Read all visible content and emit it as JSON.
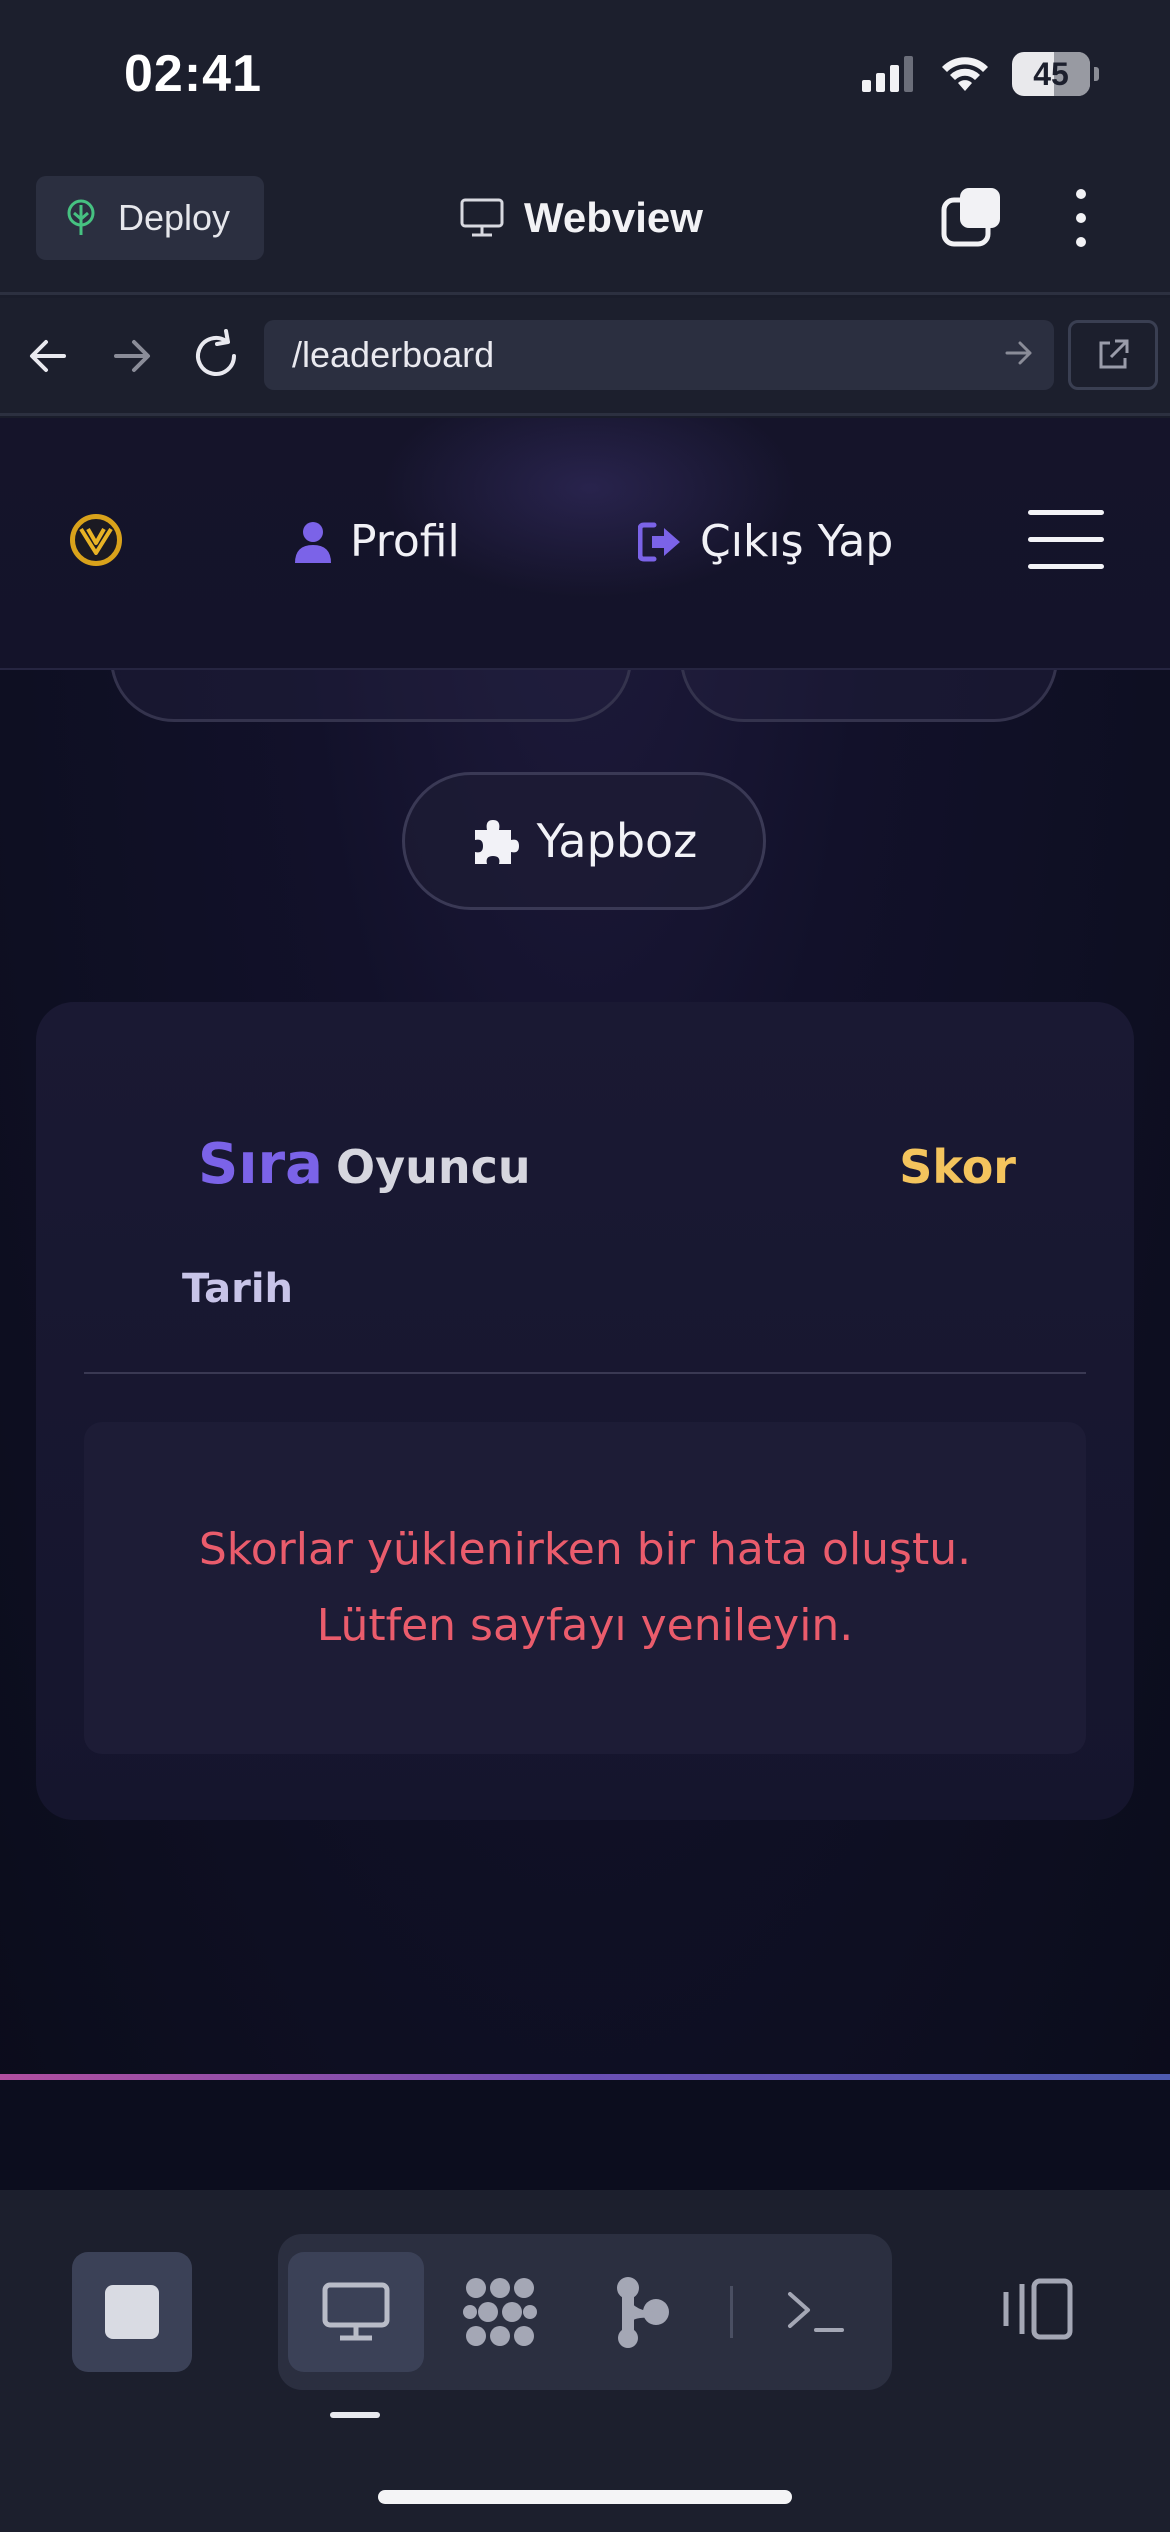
{
  "status_bar": {
    "time": "02:41",
    "battery": "45"
  },
  "toolbar": {
    "deploy_label": "Deploy",
    "webview_label": "Webview"
  },
  "url_bar": {
    "url": "/leaderboard"
  },
  "site_nav": {
    "profile_label": "Profil",
    "logout_label": "Çıkış Yap"
  },
  "games": {
    "puzzle_label": "Yapboz"
  },
  "leaderboard": {
    "col_rank": "Sıra",
    "col_player": "Oyuncu",
    "col_score": "Skor",
    "col_date": "Tarih",
    "error_message": "Skorlar yüklenirken bir hata oluştu. Lütfen sayfayı yenileyin."
  },
  "colors": {
    "accent_purple": "#7b63e8",
    "score_gold": "#f4c45d",
    "error_red": "#ea5c6c",
    "deploy_green": "#46c281"
  }
}
